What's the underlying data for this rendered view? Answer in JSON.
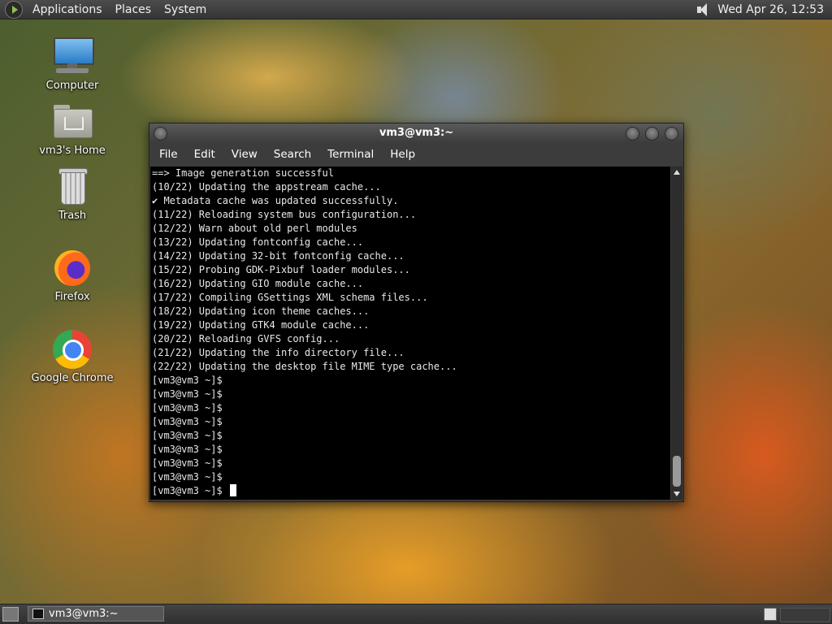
{
  "top_panel": {
    "menus": [
      "Applications",
      "Places",
      "System"
    ],
    "clock": "Wed Apr 26, 12:53"
  },
  "desktop_icons": [
    {
      "label": "Computer",
      "icon": "computer-icon"
    },
    {
      "label": "vm3's Home",
      "icon": "home-folder-icon"
    },
    {
      "label": "Trash",
      "icon": "trash-icon"
    },
    {
      "label": "Firefox",
      "icon": "firefox-icon"
    },
    {
      "label": "Google Chrome",
      "icon": "chrome-icon"
    }
  ],
  "terminal": {
    "title": "vm3@vm3:~",
    "menu": [
      "File",
      "Edit",
      "View",
      "Search",
      "Terminal",
      "Help"
    ],
    "lines": [
      "==> Image generation successful",
      "(10/22) Updating the appstream cache...",
      "✔ Metadata cache was updated successfully.",
      "(11/22) Reloading system bus configuration...",
      "(12/22) Warn about old perl modules",
      "(13/22) Updating fontconfig cache...",
      "(14/22) Updating 32-bit fontconfig cache...",
      "(15/22) Probing GDK-Pixbuf loader modules...",
      "(16/22) Updating GIO module cache...",
      "(17/22) Compiling GSettings XML schema files...",
      "(18/22) Updating icon theme caches...",
      "(19/22) Updating GTK4 module cache...",
      "(20/22) Reloading GVFS config...",
      "(21/22) Updating the info directory file...",
      "(22/22) Updating the desktop file MIME type cache...",
      "[vm3@vm3 ~]$",
      "[vm3@vm3 ~]$",
      "[vm3@vm3 ~]$",
      "[vm3@vm3 ~]$",
      "[vm3@vm3 ~]$",
      "[vm3@vm3 ~]$",
      "[vm3@vm3 ~]$",
      "[vm3@vm3 ~]$",
      "[vm3@vm3 ~]$ "
    ]
  },
  "taskbar": {
    "task_label": "vm3@vm3:~"
  }
}
